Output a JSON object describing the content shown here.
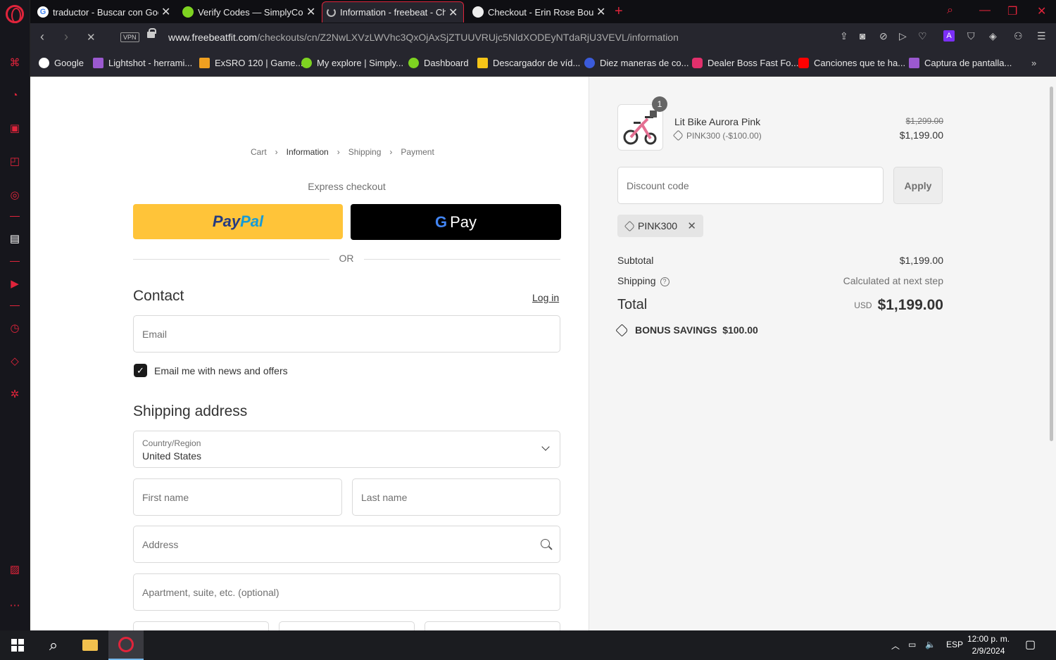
{
  "browser": {
    "tabs": [
      {
        "title": "traductor - Buscar con Google",
        "favicon": "google-icon",
        "active": false
      },
      {
        "title": "Verify Codes — SimplyCodes",
        "favicon": "simplycodes-icon",
        "active": false
      },
      {
        "title": "Information - freebeat - Checkout",
        "favicon": "loading-icon",
        "active": true
      },
      {
        "title": "Checkout - Erin Rose Boutique",
        "favicon": "shop-icon",
        "active": false
      }
    ],
    "vpn_label": "VPN",
    "url_domain": "www.freebeatfit.com",
    "url_path": "/checkouts/cn/Z2NwLXVzLWVhc3QxOjAxSjZTUUVRUjc5NldXODEyNTdaRjU3VEVL/information",
    "bookmarks": [
      {
        "label": "Google",
        "color": "#ffffff"
      },
      {
        "label": "Lightshot - herrami...",
        "color": "#9b59d0"
      },
      {
        "label": "ExSRO 120 | Game...",
        "color": "#f0a020"
      },
      {
        "label": "My explore | Simply...",
        "color": "#7ed321"
      },
      {
        "label": "Dashboard",
        "color": "#7ed321"
      },
      {
        "label": "Descargador de víd...",
        "color": "#f5c518"
      },
      {
        "label": "Diez maneras de co...",
        "color": "#3b5bdb"
      },
      {
        "label": "Dealer Boss Fast Fo...",
        "color": "#e1306c"
      },
      {
        "label": "Canciones que te ha...",
        "color": "#ff0000"
      },
      {
        "label": "Captura de pantalla...",
        "color": "#9b59d0"
      }
    ]
  },
  "checkout": {
    "breadcrumbs": [
      "Cart",
      "Information",
      "Shipping",
      "Payment"
    ],
    "express_checkout": "Express checkout",
    "paypal_label_a": "Pay",
    "paypal_label_b": "Pal",
    "gpay_g": "G",
    "gpay_label": "Pay",
    "or_label": "OR",
    "contact_heading": "Contact",
    "login_link": "Log in",
    "email_placeholder": "Email",
    "newsletter_label": "Email me with news and offers",
    "newsletter_checked": true,
    "shipping_heading": "Shipping address",
    "country_label": "Country/Region",
    "country_value": "United States",
    "first_name_placeholder": "First name",
    "last_name_placeholder": "Last name",
    "address_placeholder": "Address",
    "apartment_placeholder": "Apartment, suite, etc. (optional)"
  },
  "summary": {
    "product_name": "Lit Bike Aurora Pink",
    "quantity": "1",
    "product_discount": "PINK300 (-$100.00)",
    "original_price": "$1,299.00",
    "price": "$1,199.00",
    "discount_placeholder": "Discount code",
    "apply_label": "Apply",
    "applied_code": "PINK300",
    "subtotal_label": "Subtotal",
    "subtotal_value": "$1,199.00",
    "shipping_label": "Shipping",
    "shipping_value": "Calculated at next step",
    "total_label": "Total",
    "total_currency": "USD",
    "total_value": "$1,199.00",
    "bonus_savings": "BONUS SAVINGS  $100.00"
  },
  "taskbar": {
    "language": "ESP",
    "time": "12:00 p. m.",
    "date": "2/9/2024"
  }
}
